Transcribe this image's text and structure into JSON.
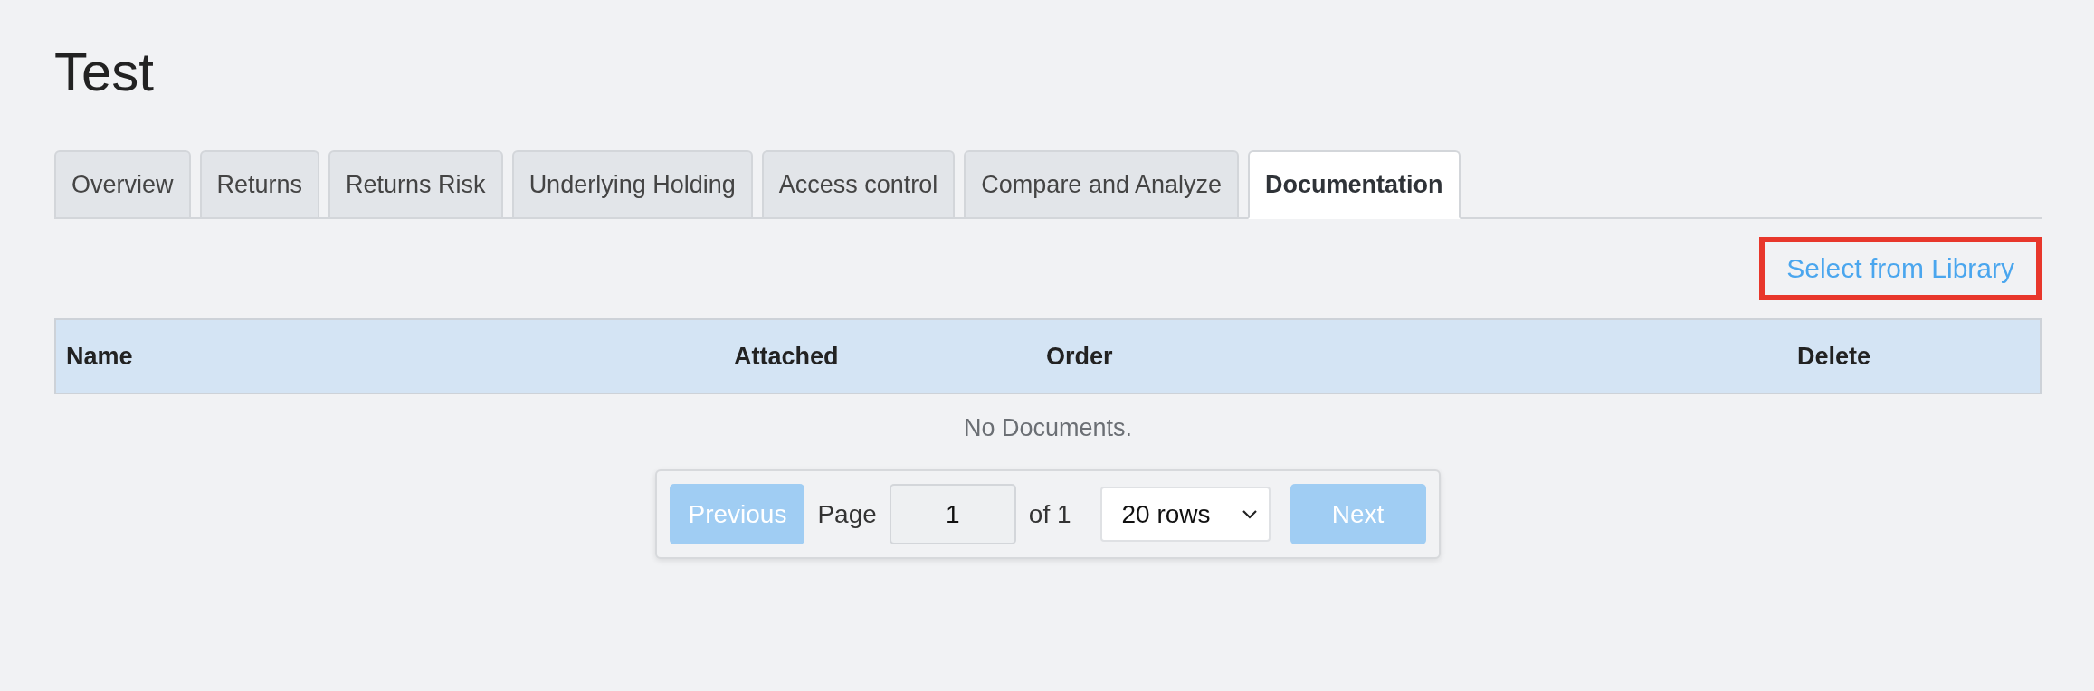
{
  "page": {
    "title": "Test"
  },
  "tabs": [
    {
      "label": "Overview",
      "selected": false
    },
    {
      "label": "Returns",
      "selected": false
    },
    {
      "label": "Returns Risk",
      "selected": false
    },
    {
      "label": "Underlying Holding",
      "selected": false
    },
    {
      "label": "Access control",
      "selected": false
    },
    {
      "label": "Compare and Analyze",
      "selected": false
    },
    {
      "label": "Documentation",
      "selected": true
    }
  ],
  "library_link": {
    "label": "Select from Library",
    "highlighted": true
  },
  "table": {
    "columns": [
      "Name",
      "Attached",
      "Order",
      "Delete"
    ],
    "empty_message": "No Documents."
  },
  "pagination": {
    "previous": {
      "label": "Previous",
      "disabled": true
    },
    "page_label": "Page",
    "page_value": "1",
    "of_label": "of 1",
    "rows_select": "20 rows",
    "next": {
      "label": "Next",
      "disabled": true
    }
  }
}
